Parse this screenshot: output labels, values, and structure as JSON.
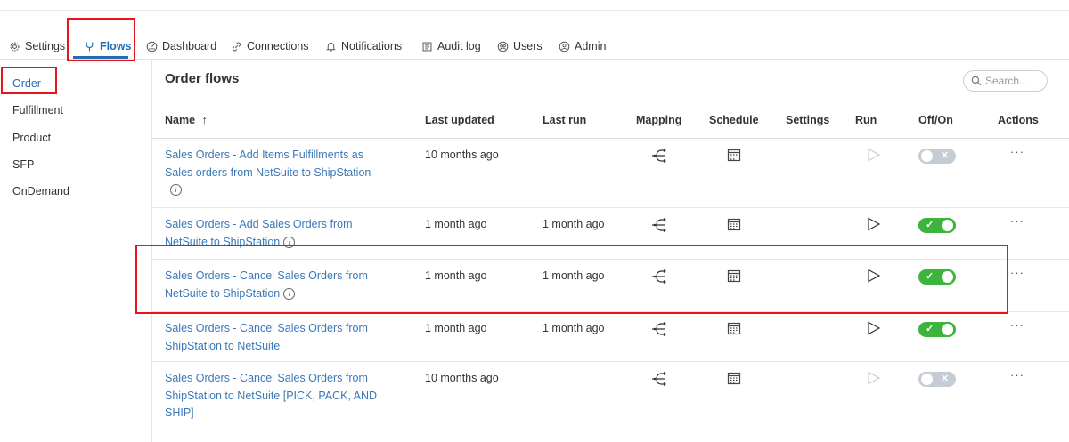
{
  "tabs": [
    {
      "label": "Settings",
      "icon": "gear-icon"
    },
    {
      "label": "Flows",
      "icon": "flows-icon"
    },
    {
      "label": "Dashboard",
      "icon": "dashboard-icon"
    },
    {
      "label": "Connections",
      "icon": "link-icon"
    },
    {
      "label": "Notifications",
      "icon": "bell-icon"
    },
    {
      "label": "Audit log",
      "icon": "audit-log-icon"
    },
    {
      "label": "Users",
      "icon": "users-icon"
    },
    {
      "label": "Admin",
      "icon": "admin-icon"
    }
  ],
  "active_tab": "Flows",
  "sidebar": {
    "items": [
      {
        "label": "Order"
      },
      {
        "label": "Fulfillment"
      },
      {
        "label": "Product"
      },
      {
        "label": "SFP"
      },
      {
        "label": "OnDemand"
      }
    ],
    "active": "Order"
  },
  "main": {
    "title": "Order flows",
    "search": {
      "placeholder": "Search..."
    },
    "columns": {
      "name": "Name",
      "sort_indicator": "↑",
      "last_updated": "Last updated",
      "last_run": "Last run",
      "mapping": "Mapping",
      "schedule": "Schedule",
      "settings": "Settings",
      "run": "Run",
      "off_on": "Off/On",
      "actions": "Actions"
    },
    "rows": [
      {
        "name": "Sales Orders - Add Items Fulfillments as Sales orders from NetSuite to ShipStation",
        "last_updated": "10 months ago",
        "last_run": "",
        "enabled": false,
        "actions": "···"
      },
      {
        "name": "Sales Orders - Add Sales Orders from NetSuite to ShipStation",
        "last_updated": "1 month ago",
        "last_run": "1 month ago",
        "enabled": true,
        "actions": "···"
      },
      {
        "name": "Sales Orders - Cancel Sales Orders from NetSuite to ShipStation",
        "last_updated": "1 month ago",
        "last_run": "1 month ago",
        "enabled": true,
        "actions": "···"
      },
      {
        "name": "Sales Orders - Cancel Sales Orders from ShipStation to NetSuite",
        "last_updated": "1 month ago",
        "last_run": "1 month ago",
        "enabled": true,
        "actions": "···"
      },
      {
        "name": "Sales Orders - Cancel Sales Orders from ShipStation to NetSuite [PICK, PACK, AND SHIP]",
        "last_updated": "10 months ago",
        "last_run": "",
        "enabled": false,
        "actions": "···"
      }
    ]
  },
  "colors": {
    "accent": "#1f6fb5",
    "link": "#3b78b8",
    "toggle_on": "#3db53d",
    "toggle_off": "#c4ccd6",
    "highlight": "#e8141b"
  }
}
